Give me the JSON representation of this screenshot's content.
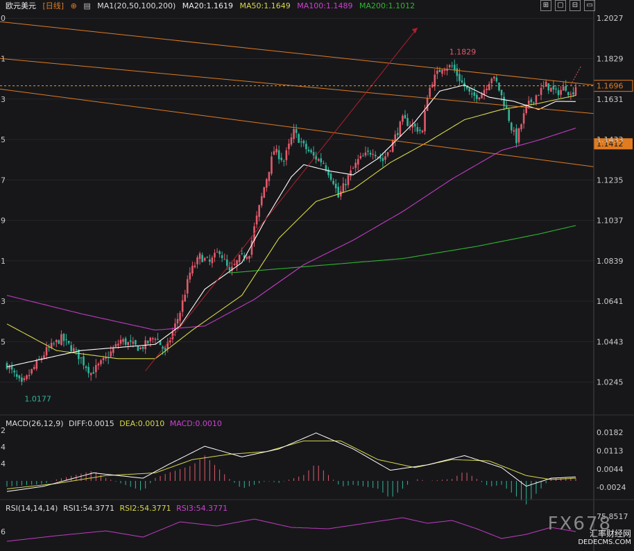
{
  "header": {
    "symbol": "欧元美元",
    "period": "[日线]",
    "ma_label": "MA1(20,50,100,200)",
    "ma20": "MA20:1.1619",
    "ma50": "MA50:1.1649",
    "ma100": "MA100:1.1489",
    "ma200": "MA200:1.1012"
  },
  "window_buttons": [
    "⊞",
    "▢",
    "⊟",
    "▭"
  ],
  "macd_header": {
    "label": "MACD(26,12,9)",
    "diff": "DIFF:0.0015",
    "dea": "DEA:0.0010",
    "macd": "MACD:0.0010"
  },
  "rsi_header": {
    "label": "RSI(14,14,14)",
    "rsi1": "RSI1:54.3771",
    "rsi2": "RSI2:54.3771",
    "rsi3": "RSI3:54.3771"
  },
  "watermark": {
    "brand": "FX678",
    "line1": "汇率财经网",
    "line2": "DEDECMS.COM"
  },
  "colors": {
    "bg": "#17171a",
    "up": "#e25a6a",
    "down": "#2fb59a",
    "ma20": "#ffffff",
    "ma50": "#d8d84a",
    "ma100": "#c03cc0",
    "ma200": "#2fb62f",
    "channel": "#e07b20",
    "trendline": "#b0202a",
    "dashed": "#e0a020"
  },
  "chart_data": {
    "type": "candlestick",
    "y_ticks": [
      "1.2027",
      "1.1829",
      "1.1631",
      "1.1433",
      "1.1235",
      "1.1037",
      "1.0839",
      "1.0641",
      "1.0443",
      "1.0245"
    ],
    "price_range": [
      1.0125,
      1.2055
    ],
    "left_tick_fragments": [
      "0",
      "1",
      "3",
      "5",
      "7",
      "9",
      "1",
      "3",
      "5"
    ],
    "current_price": "1.1696",
    "level_price": "1.1412",
    "high_label": "1.1829",
    "low_label": "1.0177",
    "macd": {
      "y_ticks": [
        "0.0182",
        "0.0113",
        "0.0044",
        "-0.0024"
      ],
      "left_ticks": [
        "2",
        "4",
        "4"
      ]
    },
    "rsi": {
      "y_ticks": [
        "75.8517"
      ],
      "left_ticks": [
        "6"
      ]
    },
    "keypoints": [
      [
        0,
        1.033
      ],
      [
        6,
        1.023
      ],
      [
        10,
        1.03
      ],
      [
        16,
        1.04
      ],
      [
        22,
        1.046
      ],
      [
        28,
        1.039
      ],
      [
        34,
        1.029
      ],
      [
        40,
        1.036
      ],
      [
        46,
        1.045
      ],
      [
        54,
        1.041
      ],
      [
        60,
        1.047
      ],
      [
        64,
        1.039
      ],
      [
        70,
        1.059
      ],
      [
        74,
        1.078
      ],
      [
        78,
        1.086
      ],
      [
        82,
        1.083
      ],
      [
        86,
        1.089
      ],
      [
        90,
        1.078
      ],
      [
        94,
        1.085
      ],
      [
        98,
        1.088
      ],
      [
        100,
        1.1
      ],
      [
        104,
        1.12
      ],
      [
        108,
        1.138
      ],
      [
        112,
        1.133
      ],
      [
        116,
        1.147
      ],
      [
        120,
        1.14
      ],
      [
        124,
        1.135
      ],
      [
        128,
        1.132
      ],
      [
        132,
        1.123
      ],
      [
        134,
        1.115
      ],
      [
        138,
        1.125
      ],
      [
        142,
        1.133
      ],
      [
        148,
        1.138
      ],
      [
        152,
        1.133
      ],
      [
        156,
        1.142
      ],
      [
        160,
        1.153
      ],
      [
        164,
        1.15
      ],
      [
        168,
        1.147
      ],
      [
        170,
        1.165
      ],
      [
        172,
        1.172
      ],
      [
        176,
        1.179
      ],
      [
        180,
        1.179
      ],
      [
        184,
        1.171
      ],
      [
        188,
        1.164
      ],
      [
        192,
        1.166
      ],
      [
        196,
        1.174
      ],
      [
        198,
        1.171
      ],
      [
        202,
        1.158
      ],
      [
        204,
        1.149
      ],
      [
        206,
        1.143
      ],
      [
        210,
        1.159
      ],
      [
        214,
        1.165
      ],
      [
        218,
        1.17
      ],
      [
        222,
        1.166
      ],
      [
        226,
        1.169
      ],
      [
        228,
        1.165
      ],
      [
        230,
        1.1696
      ]
    ],
    "ma20": [
      [
        0,
        1.032
      ],
      [
        30,
        1.04
      ],
      [
        60,
        1.043
      ],
      [
        70,
        1.052
      ],
      [
        80,
        1.07
      ],
      [
        95,
        1.083
      ],
      [
        105,
        1.105
      ],
      [
        115,
        1.125
      ],
      [
        120,
        1.131
      ],
      [
        130,
        1.128
      ],
      [
        140,
        1.126
      ],
      [
        150,
        1.134
      ],
      [
        165,
        1.152
      ],
      [
        175,
        1.167
      ],
      [
        185,
        1.17
      ],
      [
        195,
        1.164
      ],
      [
        205,
        1.162
      ],
      [
        215,
        1.158
      ],
      [
        222,
        1.162
      ],
      [
        230,
        1.1619
      ]
    ],
    "ma50": [
      [
        0,
        1.053
      ],
      [
        20,
        1.04
      ],
      [
        45,
        1.036
      ],
      [
        60,
        1.036
      ],
      [
        75,
        1.05
      ],
      [
        95,
        1.067
      ],
      [
        110,
        1.095
      ],
      [
        125,
        1.113
      ],
      [
        140,
        1.119
      ],
      [
        155,
        1.132
      ],
      [
        170,
        1.142
      ],
      [
        185,
        1.153
      ],
      [
        200,
        1.158
      ],
      [
        215,
        1.161
      ],
      [
        230,
        1.1649
      ]
    ],
    "ma100": [
      [
        0,
        1.067
      ],
      [
        30,
        1.058
      ],
      [
        60,
        1.05
      ],
      [
        80,
        1.052
      ],
      [
        100,
        1.065
      ],
      [
        120,
        1.082
      ],
      [
        140,
        1.094
      ],
      [
        160,
        1.108
      ],
      [
        180,
        1.124
      ],
      [
        200,
        1.138
      ],
      [
        215,
        1.143
      ],
      [
        230,
        1.1489
      ]
    ],
    "ma200": [
      [
        90,
        1.078
      ],
      [
        130,
        1.082
      ],
      [
        160,
        1.085
      ],
      [
        190,
        1.091
      ],
      [
        215,
        1.097
      ],
      [
        230,
        1.1012
      ]
    ]
  }
}
